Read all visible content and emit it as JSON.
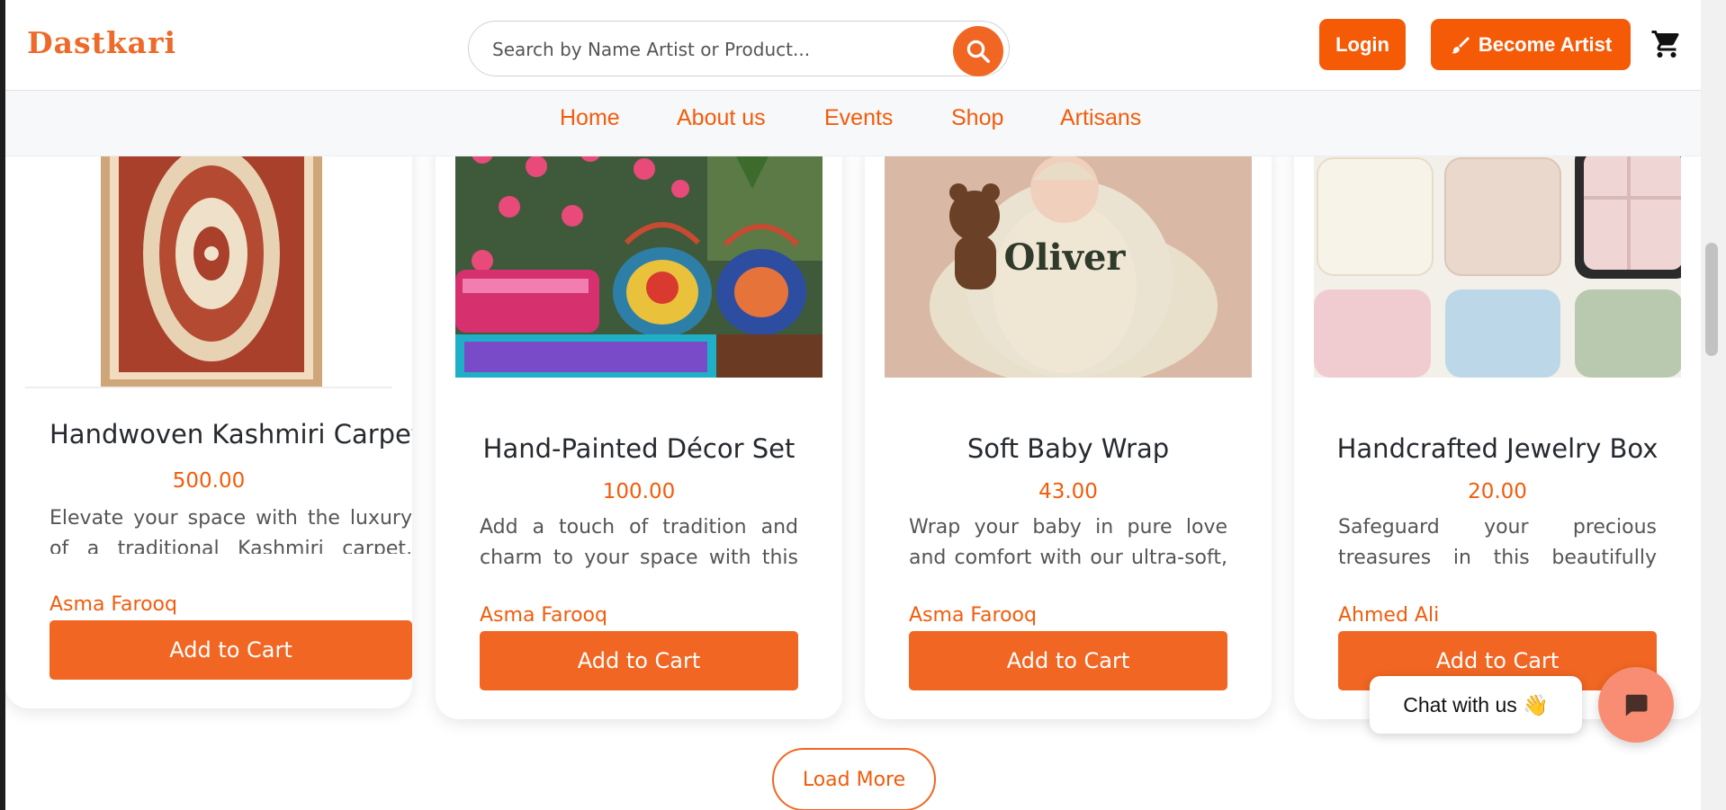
{
  "header": {
    "logo": "Dastkari",
    "search_placeholder": "Search by Name Artist or Product...",
    "login_label": "Login",
    "become_artist_label": "Become Artist",
    "accent_color": "#f16622"
  },
  "nav": {
    "items": [
      {
        "label": "Home"
      },
      {
        "label": "About us"
      },
      {
        "label": "Events"
      },
      {
        "label": "Shop"
      },
      {
        "label": "Artisans"
      }
    ]
  },
  "products": [
    {
      "title": "Handwoven Kashmiri Carpet",
      "price": "500.00",
      "description": "Elevate your space with the luxury of a traditional Kashmiri carpet, hand-knotted by skilled artisans using fine",
      "artist": "Asma Farooq",
      "button": "Add to Cart",
      "image": "carpet-image"
    },
    {
      "title": "Hand-Painted Décor Set",
      "price": "100.00",
      "description": "Add a touch of tradition and charm to your space with this hand-painted décor set. The",
      "artist": "Asma Farooq",
      "button": "Add to Cart",
      "image": "decor-set-image"
    },
    {
      "title": "Soft Baby Wrap",
      "price": "43.00",
      "description": "Wrap your baby in pure love and comfort with our ultra-soft, breathable baby cloth wrap",
      "artist": "Asma Farooq",
      "button": "Add to Cart",
      "image": "baby-wrap-image"
    },
    {
      "title": "Handcrafted Jewelry Box",
      "price": "20.00",
      "description": "Safeguard your precious treasures in this beautifully handcrafted jewelry box. Made",
      "artist": "Ahmed Ali",
      "button": "Add to Cart",
      "image": "jewelry-box-image"
    }
  ],
  "load_more_label": "Load More",
  "chat": {
    "label": "Chat with us 👋"
  }
}
